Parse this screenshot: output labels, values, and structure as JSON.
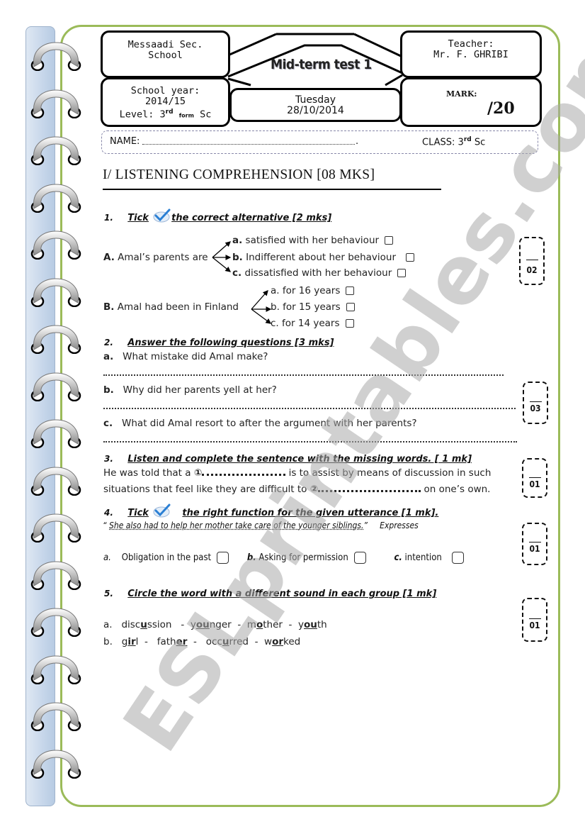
{
  "header": {
    "school_line1": "Messaadi Sec.",
    "school_line2": "School",
    "title": "Mid-term test 1",
    "teacher_label": "Teacher:",
    "teacher_name": "Mr. F. GHRIBI",
    "year_label": "School year:",
    "year_value": "2014/15",
    "level_label": "Level:",
    "level_num": "3",
    "level_sup": "rd",
    "level_form": "form",
    "level_stream": "Sc",
    "day": "Tuesday",
    "date": "28/10/2014",
    "mark_label": "MARK:",
    "mark_out_of": "/20"
  },
  "student": {
    "name_label": "NAME:",
    "class_label": "CLASS:",
    "class_num": "3",
    "class_sup": "rd",
    "class_stream": "Sc"
  },
  "section": {
    "title": "I/ LISTENING COMPREHENSION [08 MKS]"
  },
  "q1": {
    "num": "1.",
    "heading_pre": "Tick",
    "heading_post": "the correct alternative [2 mks]",
    "score": "02",
    "A": {
      "label": "A.",
      "stem": "Amal’s parents are",
      "options": [
        {
          "letter": "a.",
          "text": "satisfied with her behaviour"
        },
        {
          "letter": "b.",
          "text": "Indifferent about her behaviour"
        },
        {
          "letter": "c.",
          "text": "dissatisfied with her behaviour"
        }
      ]
    },
    "B": {
      "label": "B.",
      "stem": "Amal had been in Finland",
      "options": [
        {
          "letter": "a.",
          "text": "for 16 years"
        },
        {
          "letter": "b.",
          "text": "for 15 years"
        },
        {
          "letter": "c.",
          "text": "for 14 years"
        }
      ]
    }
  },
  "q2": {
    "num": "2.",
    "heading": "Answer the following questions [3 mks]",
    "score": "03",
    "questions": [
      {
        "letter": "a.",
        "text": "What mistake did Amal make?"
      },
      {
        "letter": "b.",
        "text": "Why did her parents yell at her?"
      },
      {
        "letter": "c.",
        "text": "What did Amal resort to after the argument with her parents?"
      }
    ]
  },
  "q3": {
    "num": "3.",
    "heading": "Listen and complete the sentence with the missing words. [ 1 mk]",
    "score": "01",
    "line1_pre": "He was told that a",
    "blank1": "①",
    "line1_post": "is to assist by means of discussion in such",
    "line2_pre": "situations that feel like they are difficult to",
    "blank2": "②",
    "line2_post": "on one’s own."
  },
  "q4": {
    "num": "4.",
    "heading_pre": "Tick",
    "heading_post": "the right function for the given utterance [1 mk].",
    "quote": "She also had to help her mother take care of the younger siblings.",
    "expresses": "Expresses",
    "score": "01",
    "options": [
      {
        "letter": "a.",
        "text": "Obligation in the past"
      },
      {
        "letter": "b.",
        "text": "Asking for permission"
      },
      {
        "letter": "c.",
        "text": "intention"
      }
    ]
  },
  "q5": {
    "num": "5.",
    "heading": "Circle the word with a different sound in each group [1 mk]",
    "score": "01",
    "groups": [
      {
        "letter": "a.",
        "words": [
          {
            "pre": "disc",
            "hl": "u",
            "post": "ssion"
          },
          {
            "pre": "y",
            "hl": "ou",
            "post": "nger"
          },
          {
            "pre": "m",
            "hl": "o",
            "post": "ther"
          },
          {
            "pre": "y",
            "hl": "ou",
            "post": "th"
          }
        ]
      },
      {
        "letter": "b.",
        "words": [
          {
            "pre": "g",
            "hl": "ir",
            "post": "l"
          },
          {
            "pre": "fath",
            "hl": "er",
            "post": ""
          },
          {
            "pre": "occ",
            "hl": "u",
            "post": "rred"
          },
          {
            "pre": "w",
            "hl": "or",
            "post": "ked"
          }
        ]
      }
    ],
    "separator": "-"
  },
  "watermark": "ESLprintables.com",
  "colors": {
    "border_green": "#9bbb59",
    "strip_blue": "#c6d6ea",
    "tick_blue": "#2a7fd4",
    "watermark_gray": "#aaaaaa"
  }
}
